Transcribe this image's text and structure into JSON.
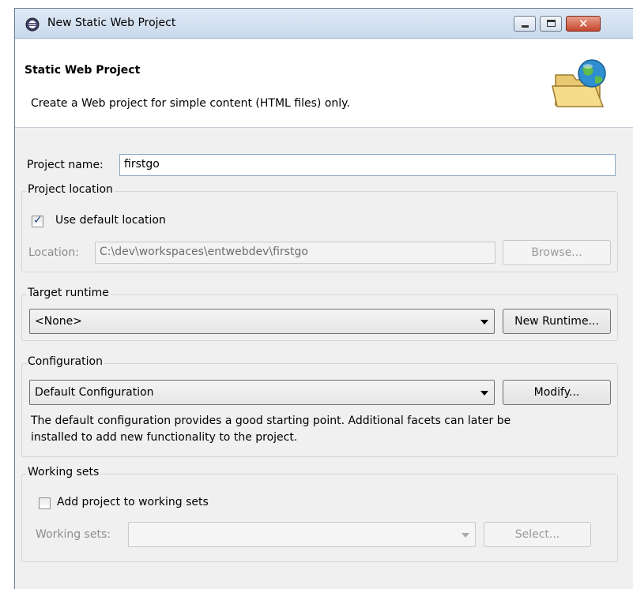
{
  "window": {
    "title": "New Static Web Project"
  },
  "banner": {
    "title": "Static Web Project",
    "description": "Create a Web project for simple content (HTML files) only."
  },
  "project_name": {
    "label": "Project name:",
    "value": "firstgo"
  },
  "project_location": {
    "group_title": "Project location",
    "use_default_label": "Use default location",
    "use_default_checked": true,
    "location_label": "Location:",
    "location_value": "C:\\dev\\workspaces\\entwebdev\\firstgo",
    "browse_label": "Browse..."
  },
  "target_runtime": {
    "group_title": "Target runtime",
    "selected": "<None>",
    "new_runtime_label": "New Runtime..."
  },
  "configuration": {
    "group_title": "Configuration",
    "selected": "Default Configuration",
    "modify_label": "Modify...",
    "description_line1": "The default configuration provides a good starting point. Additional facets can later be",
    "description_line2": "installed to add new functionality to the project."
  },
  "working_sets": {
    "group_title": "Working sets",
    "add_label": "Add project to working sets",
    "add_checked": false,
    "sets_label": "Working sets:",
    "sets_value": "",
    "select_label": "Select..."
  }
}
